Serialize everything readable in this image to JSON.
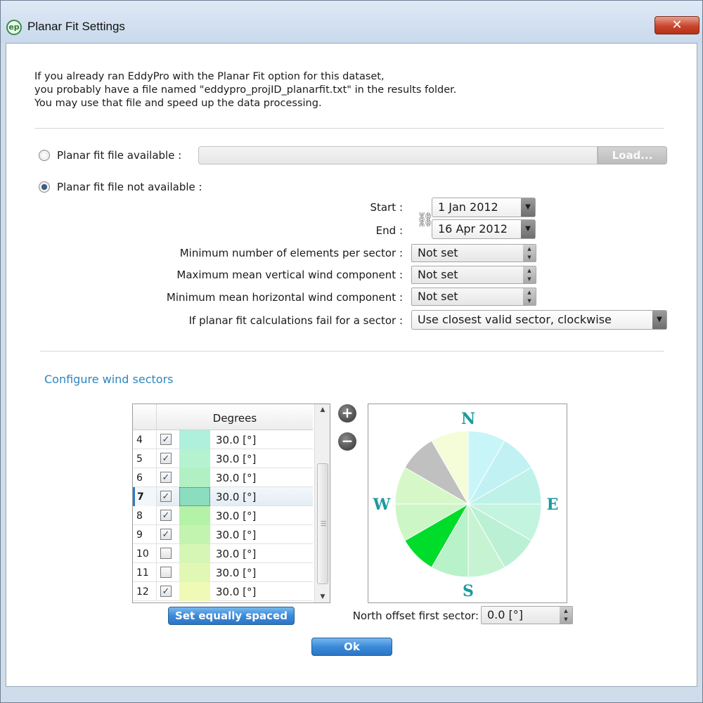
{
  "window": {
    "title": "Planar Fit Settings",
    "close_glyph": "✕"
  },
  "intro": [
    "If you already ran EddyPro with the Planar Fit option for this dataset,",
    "you probably have a file named \"eddypro_projID_planarfit.txt\" in the results folder.",
    "You may use that file and speed up the data processing."
  ],
  "options": {
    "file_available_label": "Planar fit file available :",
    "file_not_available_label": "Planar fit file not available :",
    "selected": "not_available",
    "load_button": "Load...",
    "file_path": ""
  },
  "settings": {
    "start_label": "Start :",
    "start_value": "1 Jan 2012",
    "end_label": "End :",
    "end_value": "16 Apr 2012",
    "min_elements_label": "Minimum number of elements per sector :",
    "min_elements_value": "Not set",
    "max_vertical_label": "Maximum mean vertical wind component :",
    "max_vertical_value": "Not set",
    "min_horizontal_label": "Minimum mean horizontal wind component :",
    "min_horizontal_value": "Not set",
    "fail_label": "If planar fit calculations fail for a sector :",
    "fail_value": "Use closest valid sector, clockwise"
  },
  "sectors": {
    "title": "Configure wind sectors",
    "column_header": "Degrees",
    "rows": [
      {
        "num": "4",
        "checked": true,
        "color": "#aef0dc",
        "degrees": "30.0 [°]"
      },
      {
        "num": "5",
        "checked": true,
        "color": "#b5f2d0",
        "degrees": "30.0 [°]"
      },
      {
        "num": "6",
        "checked": true,
        "color": "#b0f0c2",
        "degrees": "30.0 [°]"
      },
      {
        "num": "7",
        "checked": true,
        "color": "#8cdcc0",
        "degrees": "30.0 [°]",
        "selected": true
      },
      {
        "num": "8",
        "checked": true,
        "color": "#b4f2a8",
        "degrees": "30.0 [°]"
      },
      {
        "num": "9",
        "checked": true,
        "color": "#c2f4b0",
        "degrees": "30.0 [°]"
      },
      {
        "num": "10",
        "checked": false,
        "color": "#d6f6b6",
        "degrees": "30.0 [°]"
      },
      {
        "num": "11",
        "checked": false,
        "color": "#e0f8b4",
        "degrees": "30.0 [°]"
      },
      {
        "num": "12",
        "checked": true,
        "color": "#eefab6",
        "degrees": "30.0 [°]"
      }
    ],
    "set_equally_button": "Set equally spaced",
    "north_offset_label": "North offset first sector:",
    "north_offset_value": "0.0  [°]",
    "compass": {
      "n": "N",
      "e": "E",
      "s": "S",
      "w": "W",
      "sector_colors": [
        "#c8f6f8",
        "#c2f1f4",
        "#bef2e8",
        "#c2f4e0",
        "#bcf0d4",
        "#c6f4d2",
        "#b8f2c8",
        "#00dc2a",
        "#ccf6c6",
        "#d6f8c8",
        "#c0c0c0",
        "#f4fcd8"
      ]
    }
  },
  "ok_button": "Ok"
}
